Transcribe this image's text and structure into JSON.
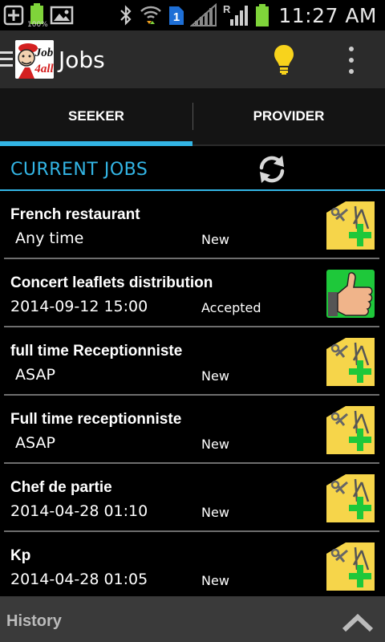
{
  "status_bar": {
    "battery_small_label": "100%",
    "sim_badge": "1",
    "roaming_label": "R",
    "time": "11:27 AM"
  },
  "action_bar": {
    "title": "Jobs",
    "logo_text_top": "Job",
    "logo_text_bottom": "4all"
  },
  "tabs": [
    {
      "label": "SEEKER",
      "active": true
    },
    {
      "label": "PROVIDER",
      "active": false
    }
  ],
  "section": {
    "title": "CURRENT JOBS"
  },
  "jobs": [
    {
      "title": "French restaurant",
      "when": " Any time",
      "status": "New",
      "icon": "add-job-icon"
    },
    {
      "title": "Concert leaflets distribution",
      "when": "2014-09-12 15:00",
      "status": "Accepted",
      "icon": "thumbs-up-icon"
    },
    {
      "title": "full time Receptionniste",
      "when": " ASAP",
      "status": "New",
      "icon": "add-job-icon"
    },
    {
      "title": "Full time receptionniste",
      "when": " ASAP",
      "status": "New",
      "icon": "add-job-icon"
    },
    {
      "title": "Chef de partie",
      "when": "2014-04-28 01:10",
      "status": "New",
      "icon": "add-job-icon"
    },
    {
      "title": "Kp",
      "when": "2014-04-28 01:05",
      "status": "New",
      "icon": "add-job-icon"
    }
  ],
  "footer": {
    "title": "History"
  },
  "colors": {
    "accent": "#33b5e5",
    "action_bar_bg": "#2b2b2b",
    "job_icon_yellow": "#f6d54a",
    "job_icon_green": "#1ec83a",
    "battery_green": "#7fd43a"
  }
}
